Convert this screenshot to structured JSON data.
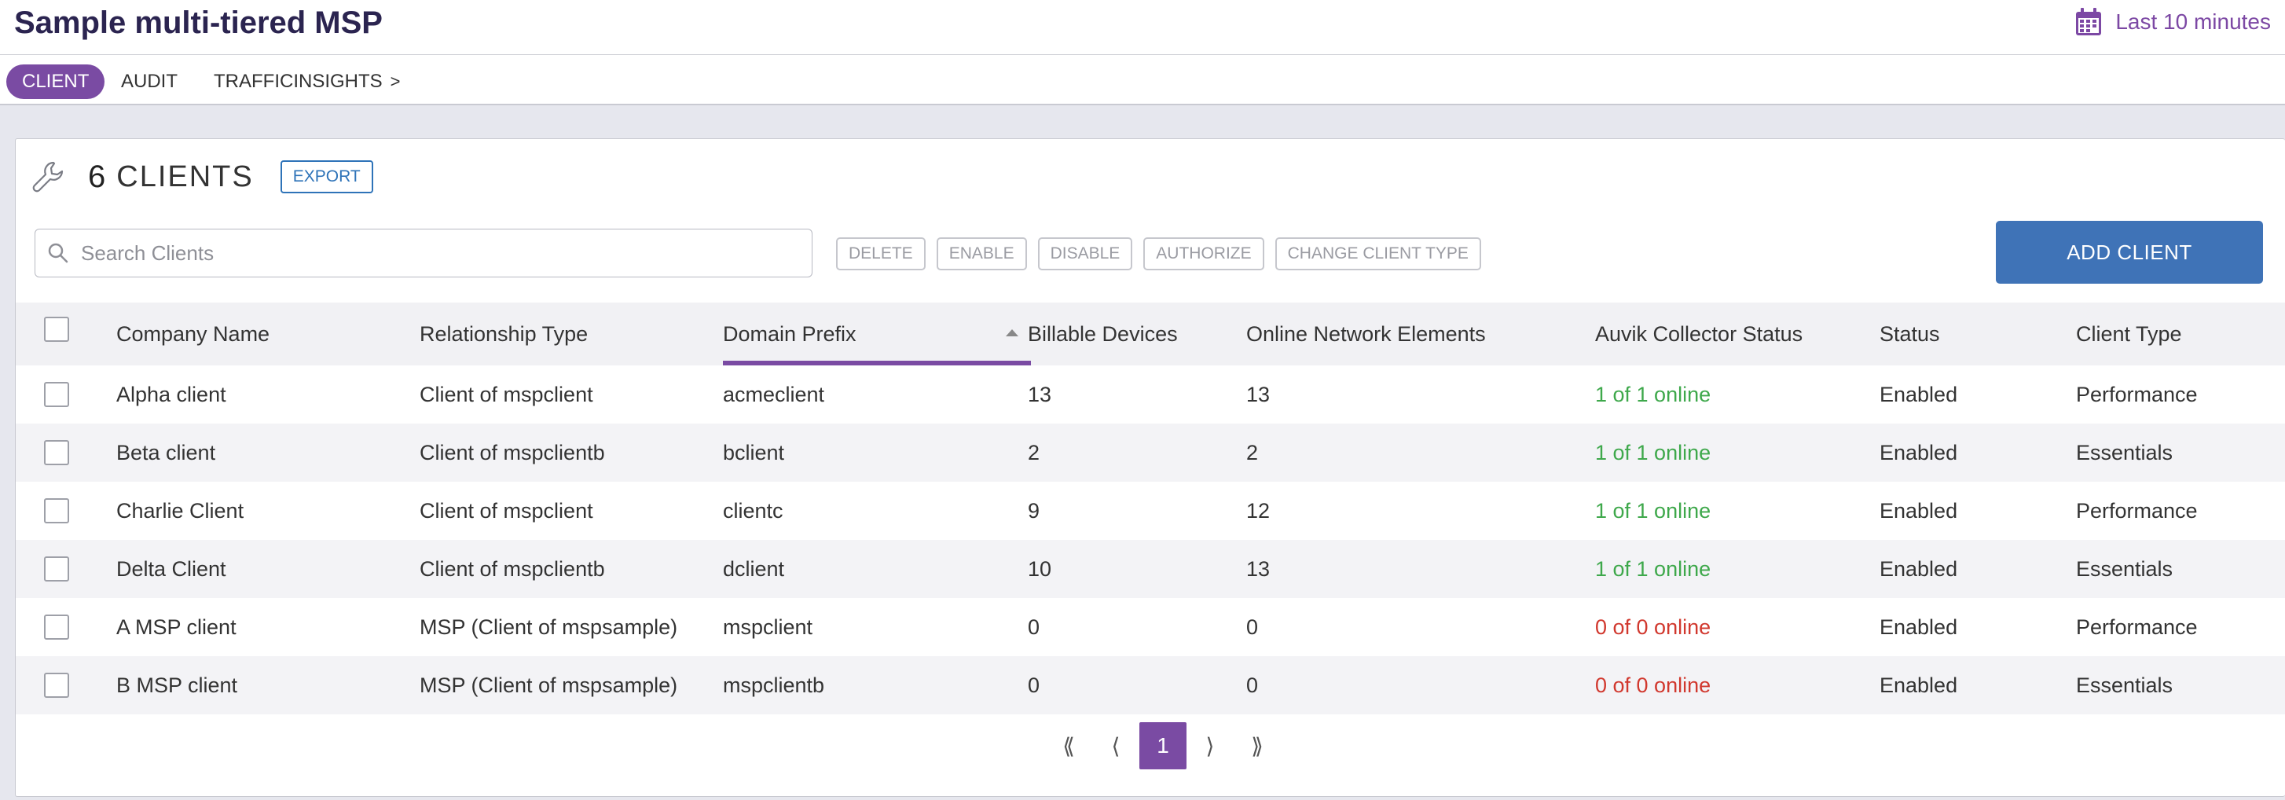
{
  "header": {
    "title": "Sample multi-tiered MSP",
    "time_range": "Last 10 minutes",
    "calendar_icon": "calendar-icon"
  },
  "tabs": [
    {
      "label": "CLIENT",
      "active": true
    },
    {
      "label": "AUDIT",
      "active": false
    },
    {
      "label": "TRAFFICINSIGHTS",
      "active": false
    }
  ],
  "clients_panel": {
    "count": "6",
    "count_label": "CLIENTS",
    "export_label": "EXPORT",
    "search_placeholder": "Search Clients",
    "actions": [
      "DELETE",
      "ENABLE",
      "DISABLE",
      "AUTHORIZE",
      "CHANGE CLIENT TYPE"
    ],
    "add_label": "ADD CLIENT"
  },
  "table": {
    "columns": [
      "Company Name",
      "Relationship Type",
      "Domain Prefix",
      "Billable Devices",
      "Online Network Elements",
      "Auvik Collector Status",
      "Status",
      "Client Type"
    ],
    "sorted_column": "Domain Prefix",
    "rows": [
      [
        "Alpha client",
        "Client of mspclient",
        "acmeclient",
        "13",
        "13",
        "1 of 1 online",
        "Enabled",
        "Performance"
      ],
      [
        "Beta client",
        "Client of mspclientb",
        "bclient",
        "2",
        "2",
        "1 of 1 online",
        "Enabled",
        "Essentials"
      ],
      [
        "Charlie Client",
        "Client of mspclient",
        "clientc",
        "9",
        "12",
        "1 of 1 online",
        "Enabled",
        "Performance"
      ],
      [
        "Delta Client",
        "Client of mspclientb",
        "dclient",
        "10",
        "13",
        "1 of 1 online",
        "Enabled",
        "Essentials"
      ],
      [
        "A MSP client",
        "MSP (Client of mspsample)",
        "mspclient",
        "0",
        "0",
        "0 of 0 online",
        "Enabled",
        "Performance"
      ],
      [
        "B MSP client",
        "MSP (Client of mspsample)",
        "mspclientb",
        "0",
        "0",
        "0 of 0 online",
        "Enabled",
        "Essentials"
      ]
    ]
  },
  "pagination": {
    "first": "⟪",
    "prev": "⟨",
    "current": "1",
    "next": "⟩",
    "last": "⟫"
  },
  "colors": {
    "accent": "#7a4ba3",
    "primary_button": "#3f73b7",
    "online_ok": "#3ea84b",
    "online_bad": "#d1382e",
    "title": "#2b2450"
  }
}
